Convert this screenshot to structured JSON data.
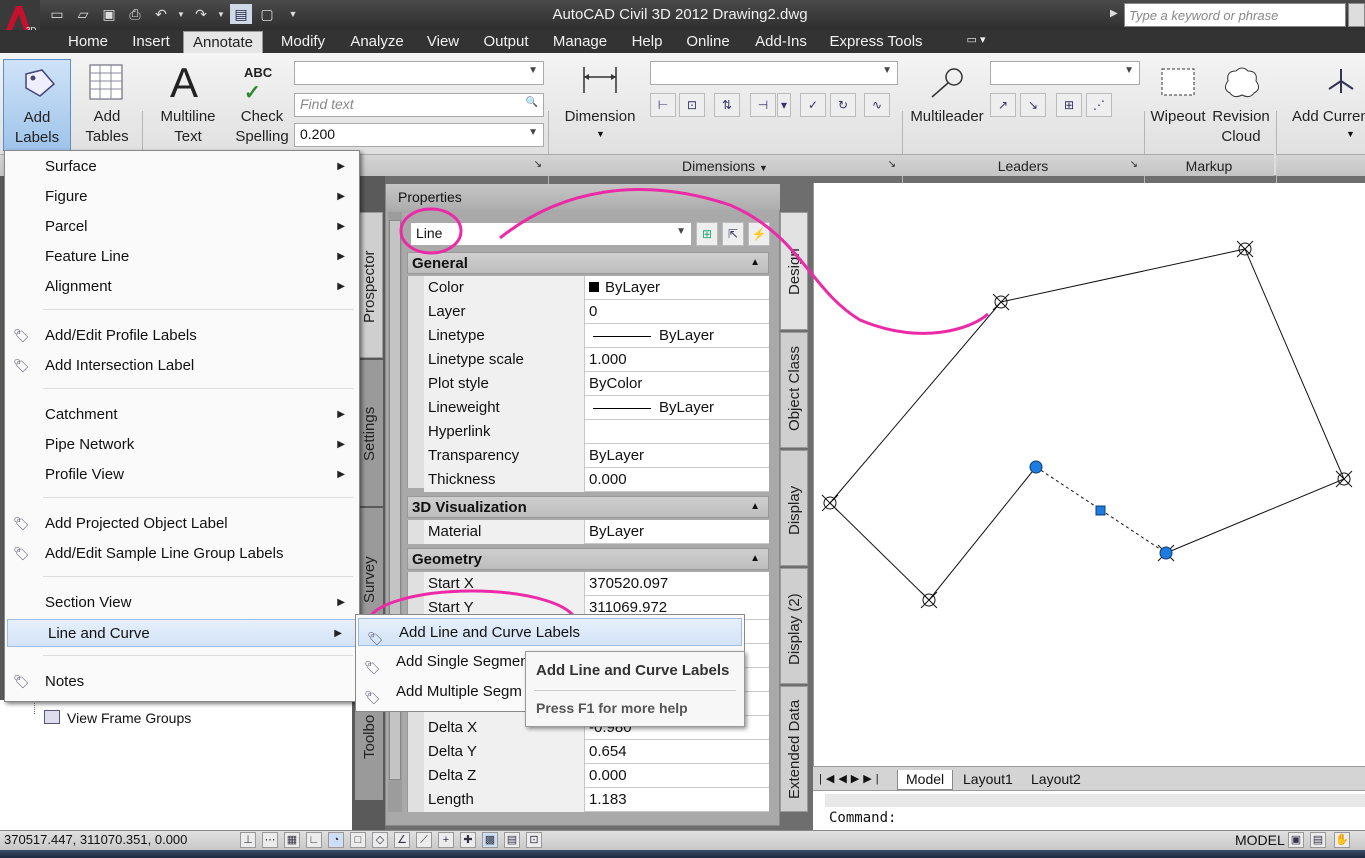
{
  "title_bar": {
    "title": "AutoCAD Civil 3D 2012    Drawing2.dwg",
    "search_placeholder": "Type a keyword or phrase",
    "logo_badge": "3D"
  },
  "ribbon_tabs": [
    "Home",
    "Insert",
    "Annotate",
    "Modify",
    "Analyze",
    "View",
    "Output",
    "Manage",
    "Help",
    "Online",
    "Add-Ins",
    "Express Tools"
  ],
  "active_tab": "Annotate",
  "ribbon": {
    "add_labels": "Add Labels",
    "add_tables": "Add Tables",
    "multiline_text": "Multiline Text",
    "check_spelling": "Check Spelling",
    "find_text_placeholder": "Find text",
    "text_height": "0.200",
    "dimension": "Dimension",
    "dimensions_panel": "Dimensions",
    "multileader": "Multileader",
    "leaders_panel": "Leaders",
    "wipeout": "Wipeout",
    "revision_cloud": "Revision Cloud",
    "markup_panel": "Markup",
    "add_current": "Add Curren"
  },
  "add_labels_menu": {
    "items": [
      {
        "label": "Surface",
        "submenu": true,
        "icon": ""
      },
      {
        "label": "Figure",
        "submenu": true,
        "icon": ""
      },
      {
        "label": "Parcel",
        "submenu": true,
        "icon": ""
      },
      {
        "label": "Feature Line",
        "submenu": true,
        "icon": ""
      },
      {
        "label": "Alignment",
        "submenu": true,
        "icon": ""
      },
      {
        "label": "Add/Edit Profile Labels",
        "submenu": false,
        "icon": "label-tag-icon"
      },
      {
        "label": "Add Intersection Label",
        "submenu": false,
        "icon": "label-tag-icon"
      },
      {
        "label": "Catchment",
        "submenu": true,
        "icon": ""
      },
      {
        "label": "Pipe Network",
        "submenu": true,
        "icon": ""
      },
      {
        "label": "Profile View",
        "submenu": true,
        "icon": ""
      },
      {
        "label": "Add Projected Object Label",
        "submenu": false,
        "icon": "label-tag-icon"
      },
      {
        "label": "Add/Edit Sample Line Group Labels",
        "submenu": false,
        "icon": "label-tag-icon"
      },
      {
        "label": "Section View",
        "submenu": true,
        "icon": ""
      },
      {
        "label": "Line and Curve",
        "submenu": true,
        "icon": "",
        "highlighted": true
      },
      {
        "label": "Notes",
        "submenu": false,
        "icon": "label-tag-icon"
      }
    ]
  },
  "line_curve_submenu": {
    "items": [
      "Add Line and Curve Labels",
      "Add Single Segmen",
      "Add Multiple Segm"
    ]
  },
  "tooltip": {
    "title": "Add Line and Curve Labels",
    "help": "Press F1 for more help"
  },
  "prospector": {
    "tree_item": "View Frame Groups",
    "side_tabs": [
      "Prospector",
      "Settings",
      "Survey",
      "Toolbo"
    ]
  },
  "properties": {
    "title": "Properties",
    "object_type": "Line",
    "sections": {
      "general": "General",
      "visualization": "3D Visualization",
      "geometry": "Geometry"
    },
    "general_rows": [
      {
        "key": "Color",
        "value": "ByLayer"
      },
      {
        "key": "Layer",
        "value": "0"
      },
      {
        "key": "Linetype",
        "value": "ByLayer"
      },
      {
        "key": "Linetype scale",
        "value": "1.000"
      },
      {
        "key": "Plot style",
        "value": "ByColor"
      },
      {
        "key": "Lineweight",
        "value": "ByLayer"
      },
      {
        "key": "Hyperlink",
        "value": ""
      },
      {
        "key": "Transparency",
        "value": "ByLayer"
      },
      {
        "key": "Thickness",
        "value": "0.000"
      }
    ],
    "visualization_rows": [
      {
        "key": "Material",
        "value": "ByLayer"
      }
    ],
    "geometry_rows": [
      {
        "key": "Start X",
        "value": "370520.097"
      },
      {
        "key": "Start Y",
        "value": "311069.972"
      },
      {
        "key": "Delta X",
        "value": "-0.980"
      },
      {
        "key": "Delta Y",
        "value": "0.654"
      },
      {
        "key": "Delta Z",
        "value": "0.000"
      },
      {
        "key": "Length",
        "value": "1.183"
      }
    ],
    "side_tabs": [
      "Design",
      "Object Class",
      "Display",
      "Display (2)",
      "Extended Data"
    ]
  },
  "layout_tabs": [
    "Model",
    "Layout1",
    "Layout2"
  ],
  "command_prompt": "Command:",
  "status": {
    "coordinates": "370517.447, 311070.351, 0.000",
    "space": "MODEL"
  },
  "colors": {
    "annotation_pink": "#ec2aa8",
    "grip_blue": "#1e7be0",
    "ribbon_dark": "#333333"
  }
}
